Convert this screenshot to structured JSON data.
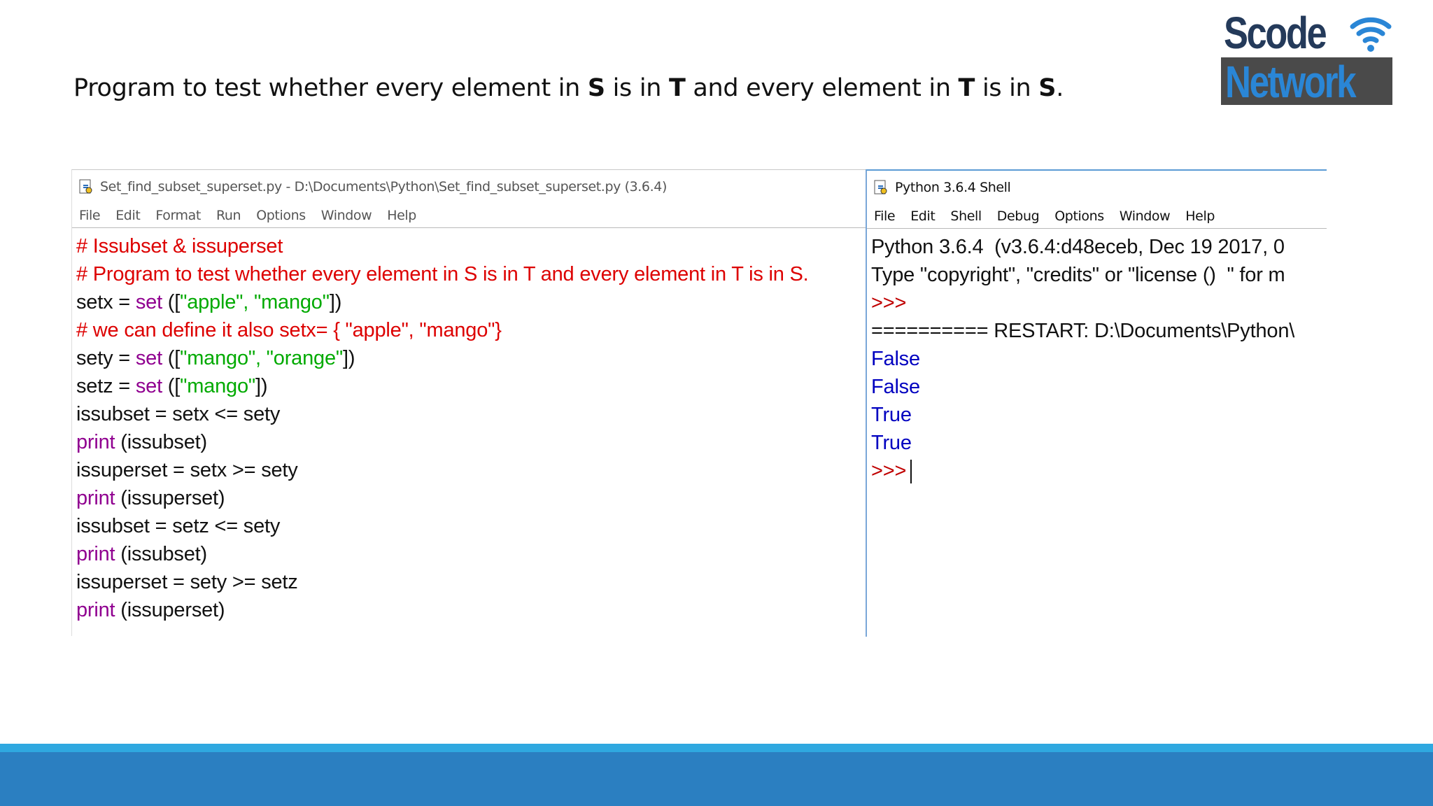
{
  "slide": {
    "title_parts": [
      "Program to test whether every element in ",
      "S",
      " is in ",
      "T",
      " and every element in ",
      "T",
      " is in ",
      "S",
      "."
    ]
  },
  "logo": {
    "top_text": "Scode",
    "bottom_text": "Network",
    "icon": "wifi-icon"
  },
  "editor": {
    "title": "Set_find_subset_superset.py - D:\\Documents\\Python\\Set_find_subset_superset.py (3.6.4)",
    "menu": [
      "File",
      "Edit",
      "Format",
      "Run",
      "Options",
      "Window",
      "Help"
    ],
    "lines": {
      "l1": "# Issubset & issuperset",
      "l2": "# Program to test whether every element in S is in T and every element in T is in S.",
      "l3a": "setx = ",
      "l3b": "set",
      "l3c": " ([",
      "l3d": "\"apple\", \"mango\"",
      "l3e": "])",
      "l4": "# we can define it also setx= { \"apple\", \"mango\"}",
      "l5a": "sety = ",
      "l5b": "set",
      "l5c": " ([",
      "l5d": "\"mango\", \"orange\"",
      "l5e": "])",
      "l6a": "setz = ",
      "l6b": "set",
      "l6c": " ([",
      "l6d": "\"mango\"",
      "l6e": "])",
      "l7": "issubset = setx <= sety",
      "l8a": "print",
      "l8b": " (issubset)",
      "l9": "issuperset = setx >= sety",
      "l10a": "print",
      "l10b": " (issuperset)",
      "l11": "issubset = setz <= sety",
      "l12a": "print",
      "l12b": " (issubset)",
      "l13": "issuperset = sety >= setz",
      "l14a": "print",
      "l14b": " (issuperset)"
    }
  },
  "shell": {
    "title": "Python 3.6.4 Shell",
    "menu": [
      "File",
      "Edit",
      "Shell",
      "Debug",
      "Options",
      "Window",
      "Help"
    ],
    "lines": {
      "banner": "Python 3.6.4  (v3.6.4:d48eceb, Dec 19 2017, 0",
      "type": "Type \"copyright\", \"credits\" or \"license ()  \" for m",
      "prompt1": ">>>",
      "restart": "========== RESTART: D:\\Documents\\Python\\",
      "out1": "False",
      "out2": "False",
      "out3": "True",
      "out4": "True",
      "prompt2": ">>>"
    }
  },
  "colors": {
    "comment": "#dd0000",
    "builtin": "#900090",
    "string": "#00aa00",
    "output": "#0000c0",
    "prompt": "#c00000",
    "footer": "#2b7fc1",
    "footer_accent": "#2fa8e0"
  }
}
